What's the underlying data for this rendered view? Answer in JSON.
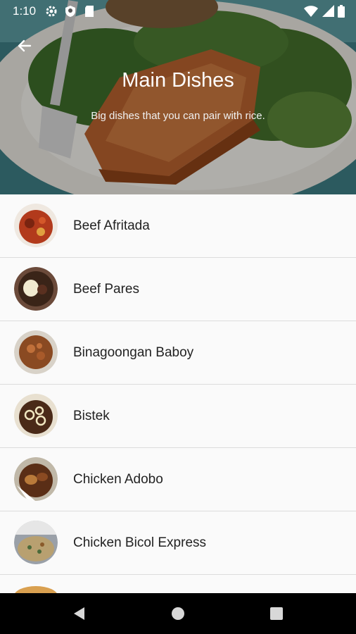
{
  "status_bar": {
    "time": "1:10"
  },
  "header": {
    "title": "Main Dishes",
    "subtitle": "Big dishes that you can pair with rice.",
    "back_icon": "arrow-left-icon"
  },
  "dishes": [
    {
      "name": "Beef Afritada",
      "thumb_colors": [
        "#b23a1c",
        "#7a2410",
        "#e0a040"
      ]
    },
    {
      "name": "Beef Pares",
      "thumb_colors": [
        "#6b4a3a",
        "#3a2418",
        "#f1ead0"
      ]
    },
    {
      "name": "Binagoongan Baboy",
      "thumb_colors": [
        "#d8d2c8",
        "#8a4a22",
        "#c0703a"
      ]
    },
    {
      "name": "Bistek",
      "thumb_colors": [
        "#e8e0d0",
        "#4a2a18",
        "#f0e6c0"
      ]
    },
    {
      "name": "Chicken Adobo",
      "thumb_colors": [
        "#c0b8a8",
        "#5a2e16",
        "#b97a3a"
      ]
    },
    {
      "name": "Chicken Bicol Express",
      "thumb_colors": [
        "#9aa0a8",
        "#b8a070",
        "#4a6a3a"
      ]
    }
  ],
  "nav": {
    "back_icon": "triangle-back-icon",
    "home_icon": "circle-home-icon",
    "recents_icon": "square-recents-icon"
  },
  "colors": {
    "list_background": "#fafafa",
    "divider": "#dcdcdc",
    "text": "#222222"
  }
}
